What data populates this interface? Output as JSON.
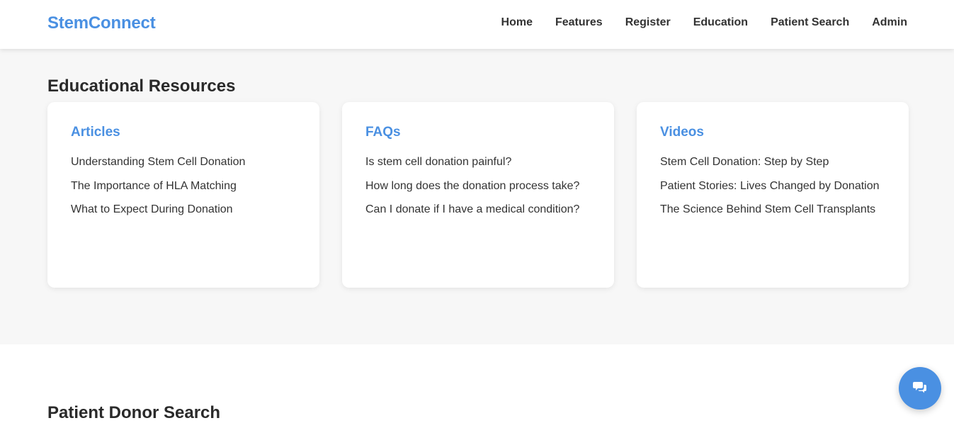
{
  "brand": {
    "logo": "StemConnect"
  },
  "nav": {
    "items": [
      {
        "label": "Home"
      },
      {
        "label": "Features"
      },
      {
        "label": "Register"
      },
      {
        "label": "Education"
      },
      {
        "label": "Patient Search"
      },
      {
        "label": "Admin"
      }
    ]
  },
  "education": {
    "title": "Educational Resources",
    "cards": [
      {
        "title": "Articles",
        "items": [
          "Understanding Stem Cell Donation",
          "The Importance of HLA Matching",
          "What to Expect During Donation"
        ]
      },
      {
        "title": "FAQs",
        "items": [
          "Is stem cell donation painful?",
          "How long does the donation process take?",
          "Can I donate if I have a medical condition?"
        ]
      },
      {
        "title": "Videos",
        "items": [
          "Stem Cell Donation: Step by Step",
          "Patient Stories: Lives Changed by Donation",
          "The Science Behind Stem Cell Transplants"
        ]
      }
    ]
  },
  "patient_search": {
    "title": "Patient Donor Search"
  },
  "chat": {
    "icon": "comments-icon"
  },
  "colors": {
    "accent": "#4a90e2",
    "text": "#333333",
    "section_bg": "#f7f7f7"
  }
}
